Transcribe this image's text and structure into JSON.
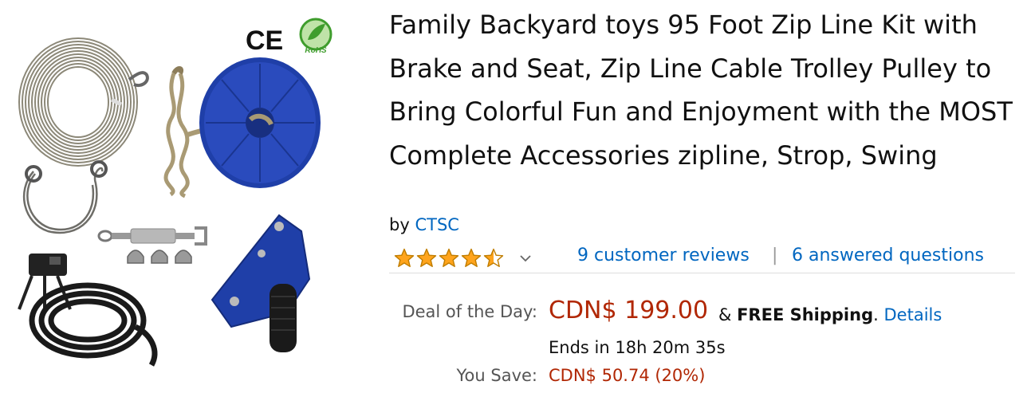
{
  "product": {
    "title": "Family Backyard toys 95 Foot Zip Line Kit with Brake and Seat, Zip Line Cable Trolley Pulley to Bring Colorful Fun and Enjoyment with the MOST Complete Accessories zipline, Strop, Swing",
    "by_prefix": "by",
    "brand": "CTSC",
    "image_badges": {
      "ce": "CE",
      "rohs": "RoHS"
    }
  },
  "rating": {
    "stars": 4.5,
    "max_stars": 5,
    "star_color": "#ffa41c",
    "icon": "chevron-down-icon",
    "reviews_text": "9 customer reviews",
    "separator": "|",
    "answered_text": "6 answered questions"
  },
  "pricing": {
    "deal_label": "Deal of the Day:",
    "price": "CDN$ 199.00",
    "amp": "&",
    "free_shipping": "FREE Shipping",
    "period": ".",
    "details_link": "Details",
    "ends_text": "Ends in 18h 20m 35s",
    "save_label": "You Save:",
    "save_value": "CDN$ 50.74 (20%)",
    "price_color": "#b12704",
    "link_color": "#0066c0"
  }
}
